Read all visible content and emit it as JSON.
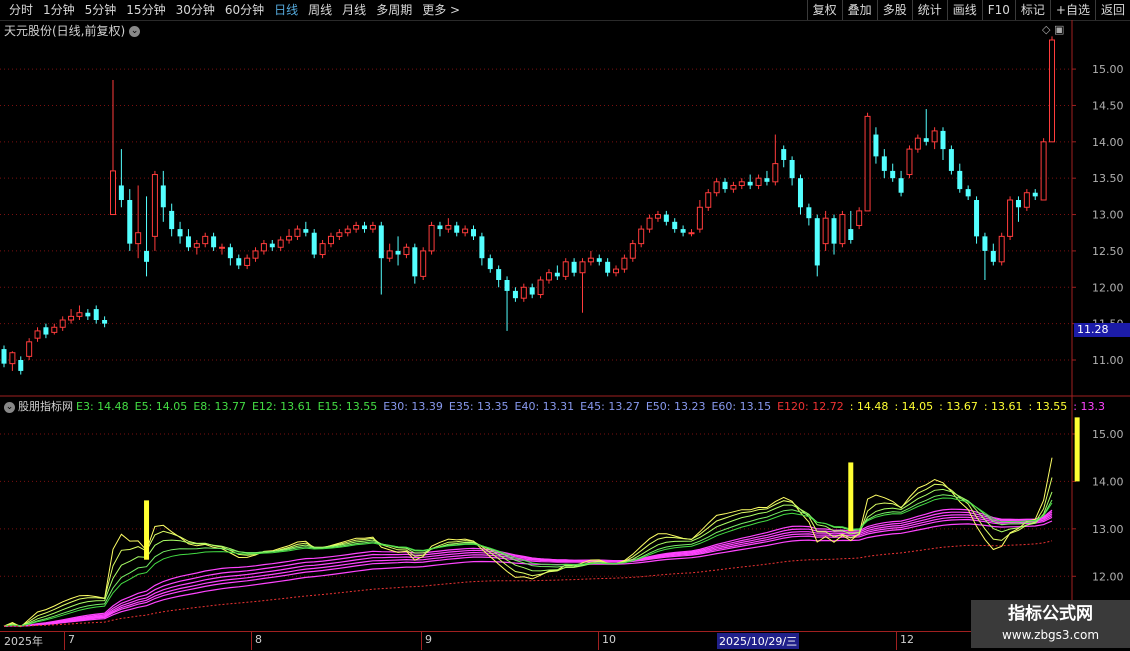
{
  "toolbar": {
    "periods": [
      "分时",
      "1分钟",
      "5分钟",
      "15分钟",
      "30分钟",
      "60分钟",
      "日线",
      "周线",
      "月线",
      "多周期",
      "更多 >"
    ],
    "actions": [
      "复权",
      "叠加",
      "多股",
      "统计",
      "画线",
      "F10",
      "标记",
      "+自选",
      "返回"
    ]
  },
  "main": {
    "title": "天元股份(日线,前复权)",
    "price_ticks": [
      "15.00",
      "14.50",
      "14.00",
      "13.50",
      "13.00",
      "12.50",
      "12.00",
      "11.50",
      "11.00"
    ],
    "current_price": "11.28",
    "icons": [
      "diamond-icon",
      "panel-toggle-icon"
    ]
  },
  "indicator": {
    "name": "股朋指标网",
    "items": [
      {
        "text": "E3: 14.48",
        "color": "#44dd44"
      },
      {
        "text": "E5: 14.05",
        "color": "#44dd44"
      },
      {
        "text": "E8: 13.77",
        "color": "#44dd44"
      },
      {
        "text": "E12: 13.61",
        "color": "#44dd44"
      },
      {
        "text": "E15: 13.55",
        "color": "#44dd44"
      },
      {
        "text": "E30: 13.39",
        "color": "#8899ee"
      },
      {
        "text": "E35: 13.35",
        "color": "#8899ee"
      },
      {
        "text": "E40: 13.31",
        "color": "#8899ee"
      },
      {
        "text": "E45: 13.27",
        "color": "#8899ee"
      },
      {
        "text": "E50: 13.23",
        "color": "#8899ee"
      },
      {
        "text": "E60: 13.15",
        "color": "#8899ee"
      },
      {
        "text": "E120: 12.72",
        "color": "#ee3333"
      },
      {
        "text": ": 14.48",
        "color": "#ffff33"
      },
      {
        "text": ": 14.05",
        "color": "#ffff33"
      },
      {
        "text": ": 13.67",
        "color": "#ffff33"
      },
      {
        "text": ": 13.61",
        "color": "#ffff33"
      },
      {
        "text": ": 13.55",
        "color": "#ffff33"
      },
      {
        "text": ": 13.3",
        "color": "#ff44ff"
      }
    ],
    "ticks": [
      "15.00",
      "14.00",
      "13.00",
      "12.00"
    ]
  },
  "xaxis": {
    "labels": [
      "2025年",
      "7",
      "8",
      "9",
      "10",
      "12"
    ],
    "cursor_date": "2025/10/29/三"
  },
  "watermark": {
    "line1": "指标公式网",
    "line2": "www.zbgs3.com"
  },
  "colors": {
    "up": "#ff3c3c",
    "down": "#54ffff",
    "grid": "#8a1010",
    "yellow": "#ffff33",
    "magenta": "#ff44ff"
  },
  "chart_data": {
    "type": "candlestick",
    "ylim": [
      10.7,
      15.5
    ],
    "candles": [
      [
        11.15,
        10.95,
        11.2,
        10.9
      ],
      [
        10.95,
        11.1,
        11.12,
        10.85
      ],
      [
        11.0,
        10.85,
        11.05,
        10.8
      ],
      [
        11.05,
        11.25,
        11.3,
        11.0
      ],
      [
        11.3,
        11.4,
        11.45,
        11.25
      ],
      [
        11.45,
        11.35,
        11.5,
        11.3
      ],
      [
        11.38,
        11.45,
        11.5,
        11.35
      ],
      [
        11.45,
        11.55,
        11.6,
        11.4
      ],
      [
        11.55,
        11.6,
        11.7,
        11.5
      ],
      [
        11.6,
        11.65,
        11.75,
        11.55
      ],
      [
        11.65,
        11.6,
        11.7,
        11.55
      ],
      [
        11.7,
        11.55,
        11.75,
        11.5
      ],
      [
        11.55,
        11.5,
        11.6,
        11.45
      ],
      [
        13.0,
        13.6,
        14.85,
        13.0
      ],
      [
        13.4,
        13.2,
        13.9,
        13.1
      ],
      [
        13.2,
        12.6,
        13.35,
        12.5
      ],
      [
        12.6,
        12.75,
        13.4,
        12.4
      ],
      [
        12.5,
        12.35,
        13.25,
        12.15
      ],
      [
        12.7,
        13.55,
        13.6,
        12.5
      ],
      [
        13.4,
        13.1,
        13.6,
        12.9
      ],
      [
        13.05,
        12.8,
        13.15,
        12.7
      ],
      [
        12.8,
        12.7,
        12.9,
        12.6
      ],
      [
        12.7,
        12.55,
        12.8,
        12.5
      ],
      [
        12.55,
        12.6,
        12.65,
        12.45
      ],
      [
        12.6,
        12.7,
        12.75,
        12.55
      ],
      [
        12.7,
        12.55,
        12.75,
        12.5
      ],
      [
        12.55,
        12.55,
        12.6,
        12.45
      ],
      [
        12.55,
        12.4,
        12.6,
        12.3
      ],
      [
        12.4,
        12.3,
        12.45,
        12.25
      ],
      [
        12.3,
        12.4,
        12.45,
        12.25
      ],
      [
        12.4,
        12.5,
        12.55,
        12.35
      ],
      [
        12.5,
        12.6,
        12.65,
        12.45
      ],
      [
        12.6,
        12.55,
        12.65,
        12.5
      ],
      [
        12.55,
        12.65,
        12.7,
        12.5
      ],
      [
        12.65,
        12.7,
        12.8,
        12.6
      ],
      [
        12.7,
        12.8,
        12.85,
        12.65
      ],
      [
        12.8,
        12.75,
        12.9,
        12.7
      ],
      [
        12.75,
        12.45,
        12.8,
        12.4
      ],
      [
        12.45,
        12.6,
        12.65,
        12.4
      ],
      [
        12.6,
        12.7,
        12.75,
        12.55
      ],
      [
        12.7,
        12.75,
        12.8,
        12.65
      ],
      [
        12.75,
        12.8,
        12.85,
        12.7
      ],
      [
        12.8,
        12.85,
        12.9,
        12.75
      ],
      [
        12.85,
        12.8,
        12.9,
        12.75
      ],
      [
        12.8,
        12.85,
        12.9,
        12.75
      ],
      [
        12.85,
        12.4,
        12.9,
        11.9
      ],
      [
        12.4,
        12.5,
        12.6,
        12.35
      ],
      [
        12.5,
        12.45,
        12.7,
        12.3
      ],
      [
        12.45,
        12.55,
        12.6,
        12.4
      ],
      [
        12.55,
        12.15,
        12.6,
        12.05
      ],
      [
        12.15,
        12.5,
        12.55,
        12.1
      ],
      [
        12.5,
        12.85,
        12.9,
        12.45
      ],
      [
        12.85,
        12.8,
        12.9,
        12.7
      ],
      [
        12.8,
        12.85,
        12.95,
        12.75
      ],
      [
        12.85,
        12.75,
        12.9,
        12.7
      ],
      [
        12.75,
        12.8,
        12.85,
        12.7
      ],
      [
        12.8,
        12.7,
        12.85,
        12.65
      ],
      [
        12.7,
        12.4,
        12.75,
        12.3
      ],
      [
        12.4,
        12.25,
        12.45,
        12.2
      ],
      [
        12.25,
        12.1,
        12.3,
        12.0
      ],
      [
        12.1,
        11.95,
        12.15,
        11.4
      ],
      [
        11.95,
        11.85,
        12.0,
        11.8
      ],
      [
        11.85,
        12.0,
        12.05,
        11.8
      ],
      [
        12.0,
        11.9,
        12.05,
        11.85
      ],
      [
        11.9,
        12.1,
        12.15,
        11.85
      ],
      [
        12.1,
        12.2,
        12.25,
        12.05
      ],
      [
        12.2,
        12.15,
        12.3,
        12.1
      ],
      [
        12.15,
        12.35,
        12.4,
        12.1
      ],
      [
        12.35,
        12.2,
        12.4,
        12.15
      ],
      [
        12.2,
        12.35,
        12.4,
        11.65
      ],
      [
        12.35,
        12.4,
        12.5,
        12.3
      ],
      [
        12.4,
        12.35,
        12.45,
        12.3
      ],
      [
        12.35,
        12.2,
        12.4,
        12.15
      ],
      [
        12.2,
        12.25,
        12.3,
        12.15
      ],
      [
        12.25,
        12.4,
        12.45,
        12.2
      ],
      [
        12.4,
        12.6,
        12.65,
        12.35
      ],
      [
        12.6,
        12.8,
        12.85,
        12.55
      ],
      [
        12.8,
        12.95,
        13.0,
        12.75
      ],
      [
        12.95,
        13.0,
        13.05,
        12.9
      ],
      [
        13.0,
        12.9,
        13.05,
        12.85
      ],
      [
        12.9,
        12.8,
        12.95,
        12.75
      ],
      [
        12.8,
        12.75,
        12.85,
        12.7
      ],
      [
        12.75,
        12.75,
        12.8,
        12.7
      ],
      [
        12.8,
        13.1,
        13.2,
        12.75
      ],
      [
        13.1,
        13.3,
        13.35,
        13.05
      ],
      [
        13.3,
        13.45,
        13.5,
        13.25
      ],
      [
        13.45,
        13.35,
        13.5,
        13.3
      ],
      [
        13.35,
        13.4,
        13.45,
        13.3
      ],
      [
        13.4,
        13.45,
        13.5,
        13.35
      ],
      [
        13.45,
        13.4,
        13.55,
        13.35
      ],
      [
        13.4,
        13.5,
        13.55,
        13.35
      ],
      [
        13.5,
        13.45,
        13.6,
        13.4
      ],
      [
        13.45,
        13.7,
        14.1,
        13.4
      ],
      [
        13.9,
        13.75,
        13.95,
        13.65
      ],
      [
        13.75,
        13.5,
        13.8,
        13.4
      ],
      [
        13.5,
        13.1,
        13.55,
        13.0
      ],
      [
        13.1,
        12.95,
        13.15,
        12.85
      ],
      [
        12.95,
        12.3,
        13.0,
        12.15
      ],
      [
        12.6,
        12.95,
        13.05,
        12.5
      ],
      [
        12.95,
        12.6,
        13.0,
        12.45
      ],
      [
        12.6,
        13.0,
        13.05,
        12.55
      ],
      [
        12.8,
        12.65,
        13.05,
        12.6
      ],
      [
        12.85,
        13.05,
        13.1,
        12.8
      ],
      [
        13.05,
        14.35,
        14.4,
        13.05
      ],
      [
        14.1,
        13.8,
        14.2,
        13.7
      ],
      [
        13.8,
        13.6,
        13.9,
        13.5
      ],
      [
        13.6,
        13.5,
        13.7,
        13.45
      ],
      [
        13.5,
        13.3,
        13.6,
        13.25
      ],
      [
        13.55,
        13.9,
        13.95,
        13.5
      ],
      [
        13.9,
        14.05,
        14.1,
        13.85
      ],
      [
        14.05,
        14.0,
        14.45,
        13.95
      ],
      [
        14.0,
        14.15,
        14.2,
        13.9
      ],
      [
        14.15,
        13.9,
        14.2,
        13.75
      ],
      [
        13.9,
        13.6,
        13.95,
        13.55
      ],
      [
        13.6,
        13.35,
        13.7,
        13.3
      ],
      [
        13.35,
        13.25,
        13.4,
        13.2
      ],
      [
        13.2,
        12.7,
        13.25,
        12.6
      ],
      [
        12.7,
        12.5,
        12.75,
        12.1
      ],
      [
        12.5,
        12.35,
        12.6,
        12.3
      ],
      [
        12.35,
        12.7,
        12.75,
        12.3
      ],
      [
        12.7,
        13.2,
        13.25,
        12.65
      ],
      [
        13.2,
        13.1,
        13.25,
        12.9
      ],
      [
        13.1,
        13.3,
        13.35,
        13.05
      ],
      [
        13.3,
        13.25,
        13.35,
        13.2
      ],
      [
        13.2,
        14.0,
        14.05,
        13.2
      ],
      [
        14.0,
        15.4,
        15.45,
        14.0
      ]
    ]
  }
}
